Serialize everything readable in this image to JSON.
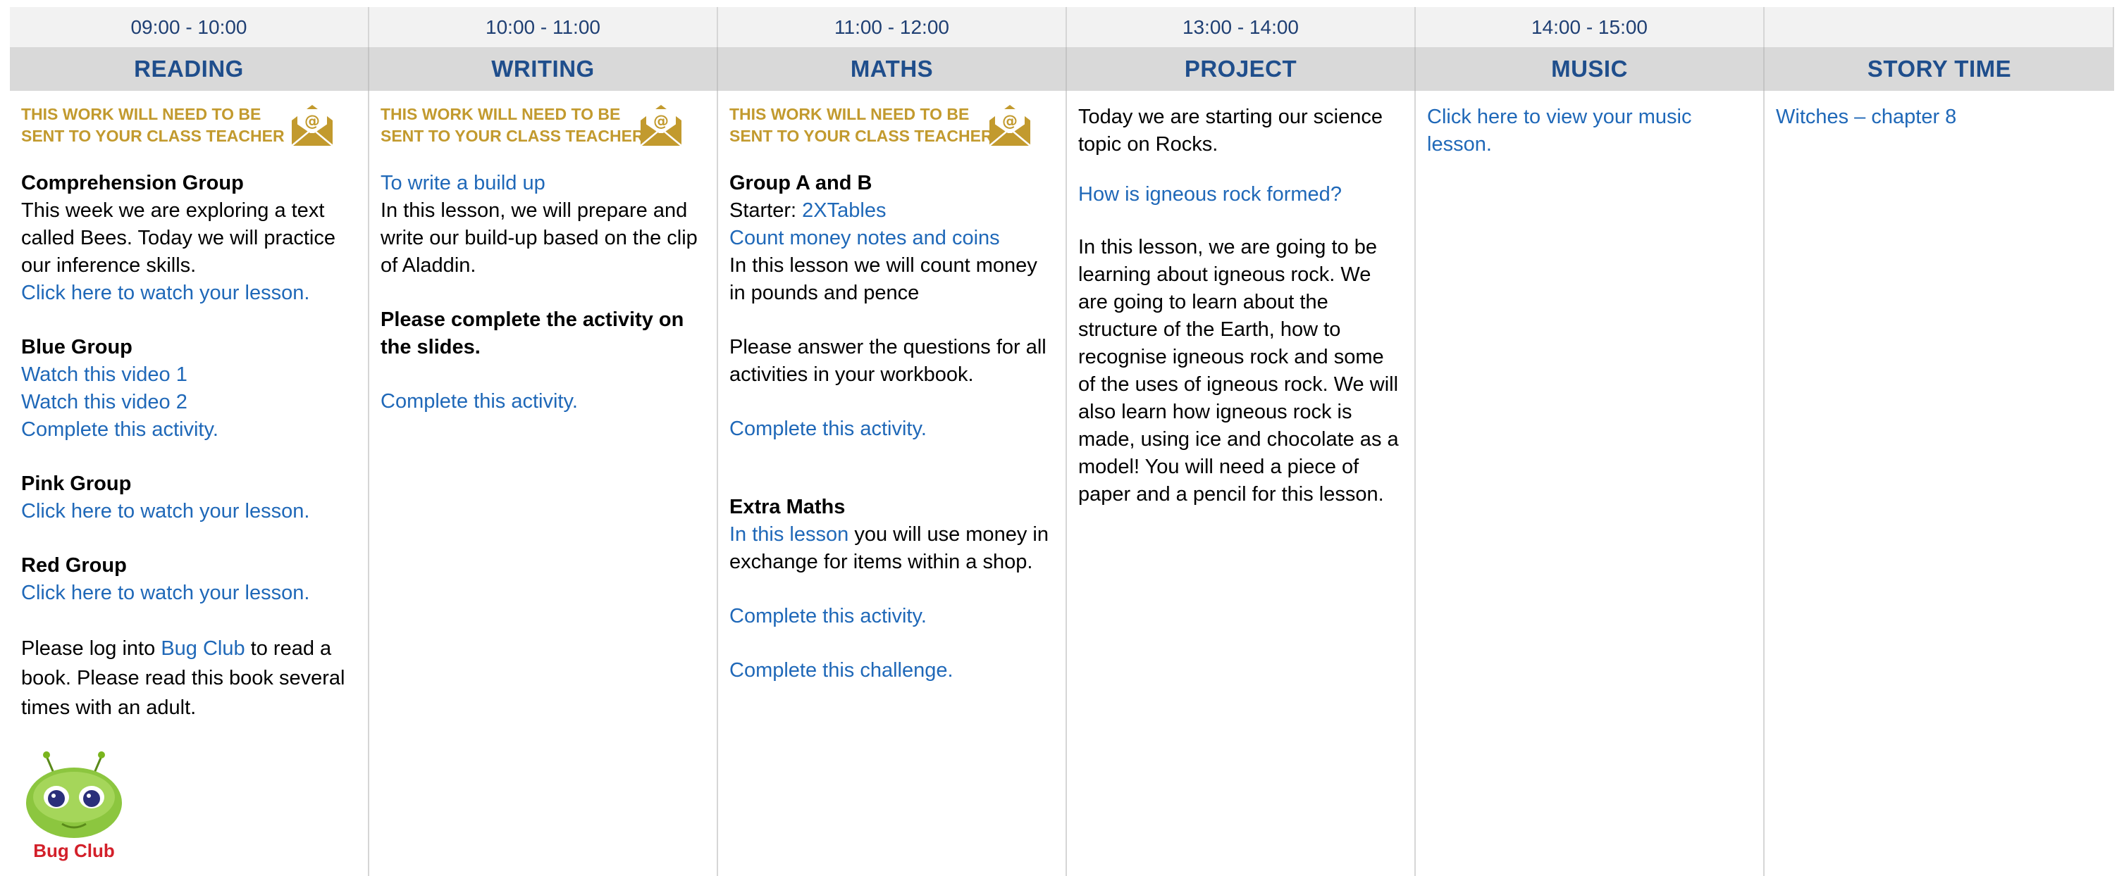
{
  "times": [
    "09:00 - 10:00",
    "10:00 - 11:00",
    "11:00 - 12:00",
    "13:00 - 14:00",
    "14:00 - 15:00",
    ""
  ],
  "subjects": [
    "READING",
    "WRITING",
    "MATHS",
    "PROJECT",
    "MUSIC",
    "STORY TIME"
  ],
  "notice": "THIS WORK WILL NEED TO BE SENT TO YOUR CLASS TEACHER",
  "reading": {
    "comprehension_heading": "Comprehension Group",
    "comprehension_text": "This week we are exploring a text called Bees. Today we will practice our inference skills.",
    "comprehension_link": "Click here to watch your lesson.",
    "blue_heading": "Blue Group",
    "blue_link1": "Watch this video 1",
    "blue_link2": "Watch this video 2",
    "blue_link3": "Complete this activity.",
    "pink_heading": "Pink Group",
    "pink_link": "Click here to watch your lesson.",
    "red_heading": "Red Group",
    "red_link": "Click here to watch your lesson.",
    "bugclub_pre": "Please log into ",
    "bugclub_link": "Bug Club",
    "bugclub_post": " to read a book. Please read this book several times with an adult.",
    "bugclub_logo_text": "Bug Club"
  },
  "writing": {
    "title_link": "To write a build up",
    "text": "In this lesson, we will prepare and write our build-up based on the clip of Aladdin.",
    "instruction": "Please complete the activity on the slides.",
    "activity_link": "Complete this activity."
  },
  "maths": {
    "group_heading": "Group A and B",
    "starter_label": "Starter: ",
    "starter_link": "2XTables",
    "count_link": "Count money notes and coins",
    "text": "In this lesson we will count money in pounds and pence",
    "instruction": "Please answer the questions for all activities in your workbook.",
    "activity_link": "Complete this activity.",
    "extra_heading": "Extra Maths",
    "extra_link": "In this lesson",
    "extra_text": " you will use money in exchange for items within a shop.",
    "extra_activity_link": "Complete this activity.",
    "challenge_link": "Complete this challenge."
  },
  "project": {
    "intro": "Today we are starting our science topic on Rocks.",
    "question_link": "How is igneous rock formed?",
    "text": "In this lesson, we are going to be learning about igneous rock. We are going to learn about the structure of the Earth, how to recognise igneous rock and some of the uses of igneous rock. We will also learn how igneous rock is made, using ice and chocolate as a model! You will need a piece of paper and a pencil for this lesson."
  },
  "music": {
    "link": "Click here to view your music lesson."
  },
  "story": {
    "link": "Witches – chapter 8"
  },
  "colors": {
    "link": "#1f68b8",
    "notice": "#c29a2e",
    "header_text": "#1f4e8c",
    "time_text": "#1f3f73",
    "header_bg": "#d9d9d9",
    "time_bg": "#f2f2f2"
  }
}
